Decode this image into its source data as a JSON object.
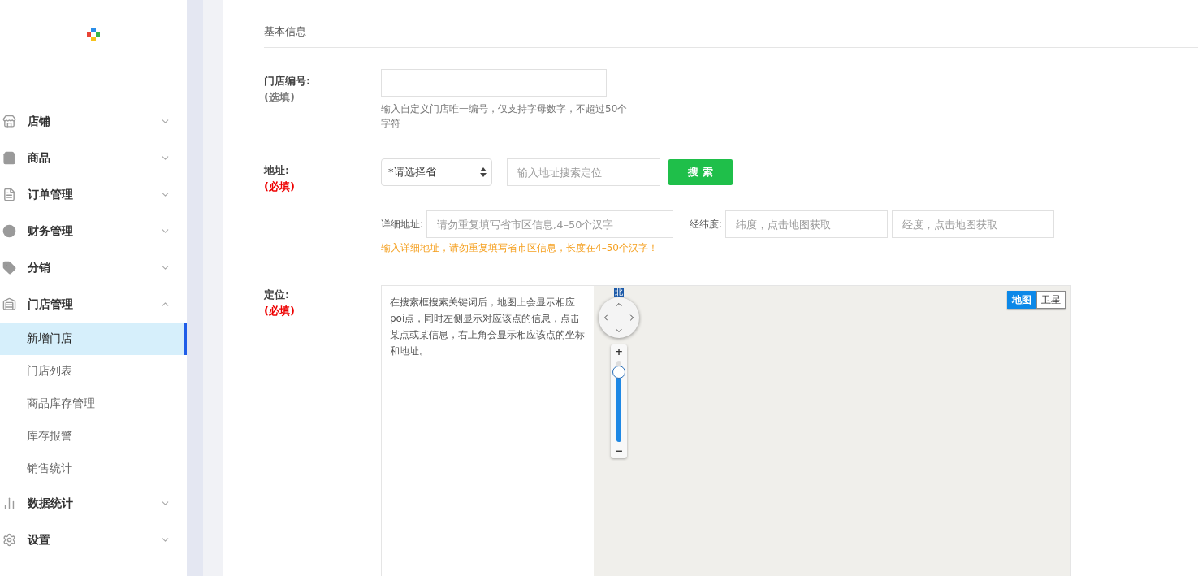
{
  "sidebar": {
    "menu": [
      {
        "label": "店铺",
        "expanded": false
      },
      {
        "label": "商品",
        "expanded": false
      },
      {
        "label": "订单管理",
        "expanded": false
      },
      {
        "label": "财务管理",
        "expanded": false
      },
      {
        "label": "分销",
        "expanded": false
      },
      {
        "label": "门店管理",
        "expanded": true,
        "children": [
          {
            "label": "新增门店",
            "selected": true
          },
          {
            "label": "门店列表",
            "selected": false
          },
          {
            "label": "商品库存管理",
            "selected": false
          },
          {
            "label": "库存报警",
            "selected": false
          },
          {
            "label": "销售统计",
            "selected": false
          }
        ]
      },
      {
        "label": "数据统计",
        "expanded": false
      },
      {
        "label": "设置",
        "expanded": false
      }
    ]
  },
  "section_title": "基本信息",
  "store_number": {
    "label": "门店编号:",
    "note": "(选填)",
    "required": false,
    "hint": "输入自定义门店唯一编号，仅支持字母数字，不超过50个字符"
  },
  "address": {
    "label": "地址:",
    "note": "(必填)",
    "required": true,
    "province": "*请选择省",
    "search_placeholder": "输入地址搜索定位",
    "search_button": "搜 索",
    "detail_label": "详细地址:",
    "detail_placeholder": "请勿重复填写省市区信息,4–50个汉字",
    "coord_label": "经纬度:",
    "lat_placeholder": "纬度，点击地图获取",
    "lng_placeholder": "经度，点击地图获取",
    "warning": "输入详细地址，请勿重复填写省市区信息，长度在4–50个汉字！"
  },
  "location": {
    "label": "定位:",
    "note": "(必填)",
    "required": true,
    "help": "在搜索框搜索关键词后，地图上会显示相应poi点，同时左侧显示对应该点的信息，点击某点或某信息，右上角会显示相应该点的坐标和地址。",
    "map": {
      "north": "北",
      "zoom_in": "+",
      "zoom_out": "−",
      "zoom": {
        "level": 0.86
      },
      "types": [
        {
          "label": "地图",
          "selected": true
        },
        {
          "label": "卫星",
          "selected": false
        }
      ]
    }
  }
}
